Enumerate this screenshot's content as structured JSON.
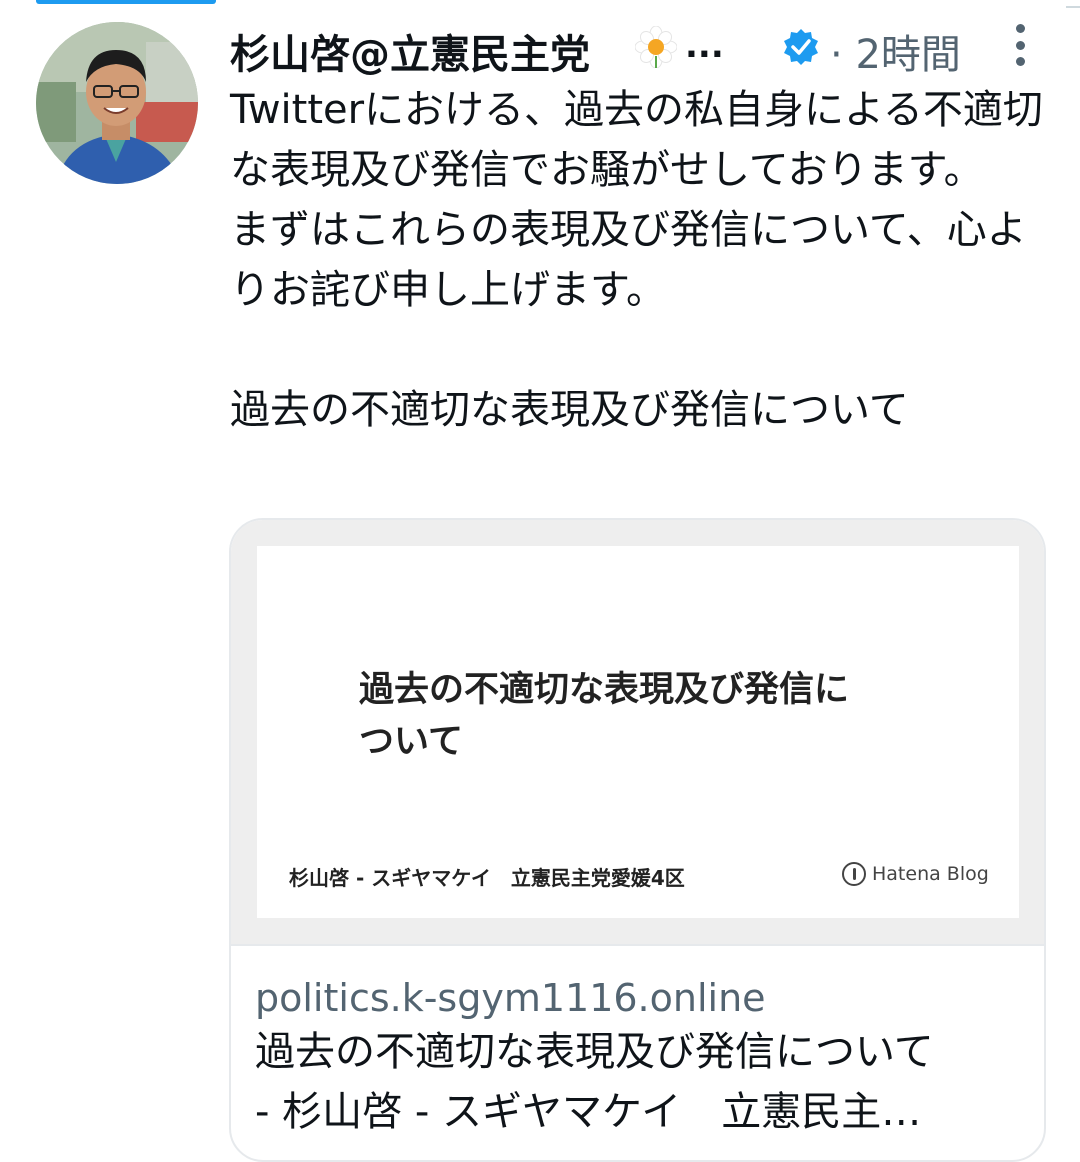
{
  "tweet": {
    "display_name": "杉山啓@立憲民主党",
    "name_overflow": "...",
    "time_sep": "·",
    "time": "2時間",
    "text": "Twitterにおける、過去の私自身による不適切な表現及び発信でお騒がせしております。\nまずはこれらの表現及び発信について、心よりお詫び申し上げます。\n\n過去の不適切な表現及び発信について"
  },
  "card": {
    "image_title": "過去の不適切な表現及び発信に\nついて",
    "image_site": "杉山啓 - スギヤマケイ　立憲民主党愛媛4区",
    "image_brand": "Hatena Blog",
    "domain": "politics.k-sgym1116.online",
    "title_line1": "過去の不適切な表現及び発信について",
    "title_line2": "- 杉山啓 - スギヤマケイ　立憲民主…"
  },
  "colors": {
    "accent": "#1d9bf0",
    "secondary_text": "#536471",
    "primary_text": "#0f1419",
    "border": "#e6e9ec"
  },
  "icons": [
    "flower-emoji-icon",
    "verified-badge-icon",
    "more-options-icon",
    "hatena-blog-icon"
  ]
}
